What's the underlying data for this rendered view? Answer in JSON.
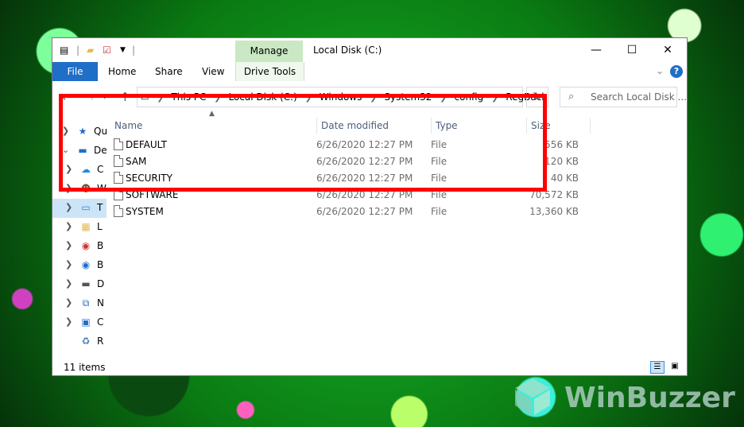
{
  "window": {
    "title": "Local Disk (C:)",
    "manage_tab": "Manage",
    "controls": {
      "minimize": "—",
      "maximize": "☐",
      "close": "✕"
    }
  },
  "quick_access_icons": [
    "properties-icon",
    "folder-icon",
    "checkmark-icon",
    "dropdown-icon"
  ],
  "ribbon": {
    "tabs": [
      "File",
      "Home",
      "Share",
      "View"
    ],
    "drive_tools": "Drive Tools",
    "help": "?"
  },
  "address": {
    "crumbs": [
      "This PC",
      "Local Disk (C:)",
      "Windows",
      "System32",
      "config",
      "RegBack"
    ]
  },
  "search": {
    "placeholder": "Search Local Disk ..."
  },
  "nav_pane": {
    "items": [
      {
        "label": "Qu",
        "icon": "star-icon",
        "has_chevron": true
      },
      {
        "label": "De",
        "icon": "desktop-icon",
        "expanded": true
      },
      {
        "label": "C",
        "icon": "onedrive-icon",
        "has_chevron": true
      },
      {
        "label": "W",
        "icon": "user-icon",
        "has_chevron": true
      },
      {
        "label": "T",
        "icon": "this-pc-icon",
        "has_chevron": true,
        "selected": true
      },
      {
        "label": "L",
        "icon": "libraries-icon",
        "has_chevron": true
      },
      {
        "label": "B",
        "icon": "drive-icon",
        "has_chevron": true
      },
      {
        "label": "B",
        "icon": "drive-icon",
        "has_chevron": true
      },
      {
        "label": "D",
        "icon": "disk-icon",
        "has_chevron": true
      },
      {
        "label": "N",
        "icon": "network-icon",
        "has_chevron": true
      },
      {
        "label": "C",
        "icon": "control-panel-icon",
        "has_chevron": true
      },
      {
        "label": "R",
        "icon": "recycle-bin-icon",
        "has_chevron": false
      }
    ]
  },
  "columns": {
    "name": "Name",
    "date": "Date modified",
    "type": "Type",
    "size": "Size"
  },
  "files": [
    {
      "name": "DEFAULT",
      "date": "6/26/2020 12:27 PM",
      "type": "File",
      "size": "556 KB"
    },
    {
      "name": "SAM",
      "date": "6/26/2020 12:27 PM",
      "type": "File",
      "size": "120 KB"
    },
    {
      "name": "SECURITY",
      "date": "6/26/2020 12:27 PM",
      "type": "File",
      "size": "40 KB"
    },
    {
      "name": "SOFTWARE",
      "date": "6/26/2020 12:27 PM",
      "type": "File",
      "size": "70,572 KB"
    },
    {
      "name": "SYSTEM",
      "date": "6/26/2020 12:27 PM",
      "type": "File",
      "size": "13,360 KB"
    }
  ],
  "status": {
    "items": "11 items"
  },
  "watermark": {
    "text": "WinBuzzer"
  },
  "colors": {
    "highlight": "#ff0000",
    "file_tab": "#1f6ec7",
    "manage_tab": "#c9e8c3"
  }
}
